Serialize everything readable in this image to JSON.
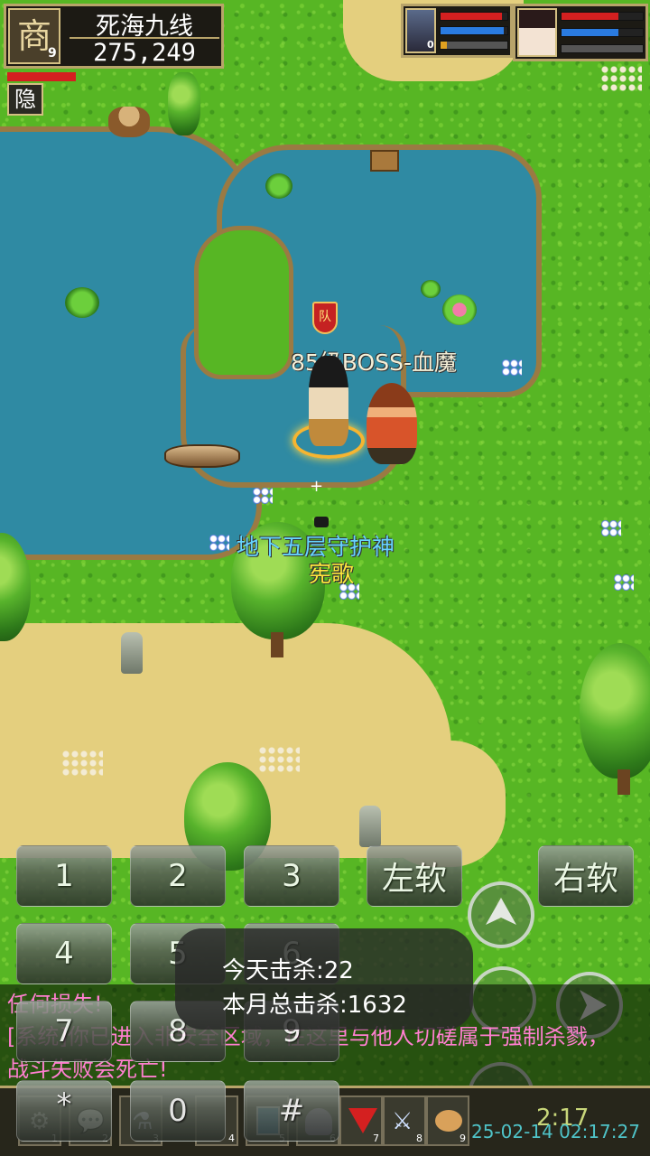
{
  "map": {
    "name": "死海九线",
    "gold": "275,249",
    "badge_char": "商",
    "level": "9",
    "hide_button": "隐"
  },
  "world_labels": {
    "boss": "85级BOSS-血魔",
    "guard": "地下五层守护神",
    "player": "宪歌",
    "guild_flag": "队"
  },
  "party": [
    {
      "level": "0",
      "hp": 0.92,
      "mp": 0.95,
      "xp": 0.1
    },
    {
      "level": "",
      "hp": 0.7,
      "mp": 0.7,
      "xp": 0.0
    }
  ],
  "keypad": {
    "k1": "1",
    "k2": "2",
    "k3": "3",
    "k4": "4",
    "k5": "5",
    "k6": "6",
    "k7": "7",
    "k8": "8",
    "k9": "9",
    "kstar": "*",
    "k0": "0",
    "khash": "#",
    "left_soft": "左软",
    "right_soft": "右软"
  },
  "toast": {
    "today_kills": "今天击杀:22",
    "month_kills": "本月总击杀:1632"
  },
  "chat": [
    {
      "text": "任何损失!",
      "color": "#ff7fd0"
    },
    {
      "text": "[系统]你已进入非安全区域，在这里与他人切磋属于强制杀戮，",
      "color": "#ff7fd0"
    },
    {
      "text": "战斗失败会死亡!",
      "color": "#ff7fd0"
    }
  ],
  "skills": [
    "1",
    "2",
    "3",
    "4",
    "5",
    "6",
    "7",
    "8",
    "9"
  ],
  "clock": "2:17",
  "datestamp": "25-02-14 02:17:27",
  "colors": {
    "hp": "#d42020",
    "mp": "#2a7be0",
    "xp": "#e0a020"
  }
}
